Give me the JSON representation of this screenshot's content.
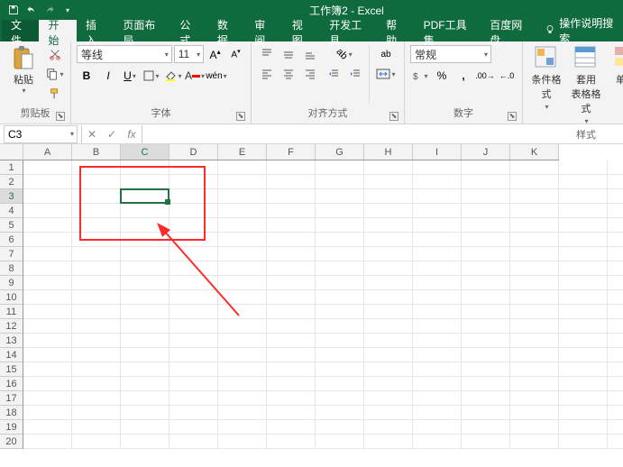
{
  "title": "工作簿2 - Excel",
  "tabs": {
    "file": "文件",
    "home": "开始",
    "insert": "插入",
    "layout": "页面布局",
    "formulas": "公式",
    "data": "数据",
    "review": "审阅",
    "view": "视图",
    "dev": "开发工具",
    "help": "帮助",
    "pdf": "PDF工具集",
    "baidu": "百度网盘"
  },
  "tellme": "操作说明搜索",
  "clipboard": {
    "paste": "粘贴",
    "group": "剪贴板"
  },
  "font": {
    "name": "等线",
    "size": "11",
    "pinyin": "wén",
    "group": "字体"
  },
  "align": {
    "group": "对齐方式",
    "wrap": "ab"
  },
  "number": {
    "format": "常规",
    "group": "数字"
  },
  "styles": {
    "cond": "条件格式",
    "table": "套用\n表格格式",
    "cell": "单元",
    "group": "样式"
  },
  "namebox": "C3",
  "columns": [
    "A",
    "B",
    "C",
    "D",
    "E",
    "F",
    "G",
    "H",
    "I",
    "J",
    "K"
  ],
  "rows": [
    "1",
    "2",
    "3",
    "4",
    "5",
    "6",
    "7",
    "8",
    "9",
    "10",
    "11",
    "12",
    "13",
    "14",
    "15",
    "16",
    "17",
    "18",
    "19",
    "20"
  ],
  "sel": {
    "col": 2,
    "row": 2
  }
}
